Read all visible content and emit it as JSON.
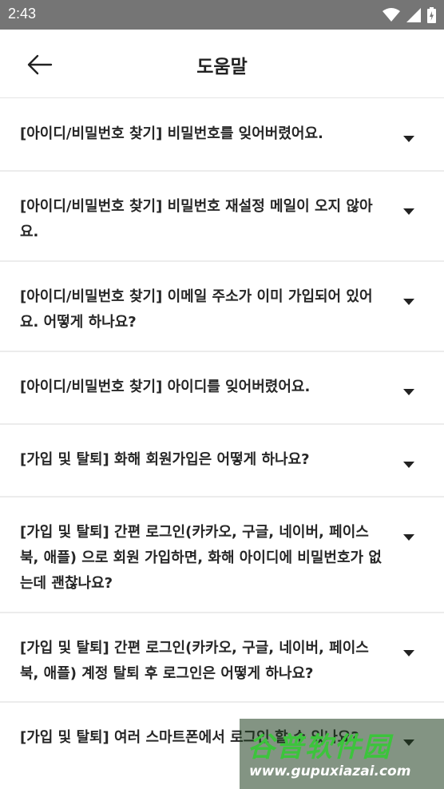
{
  "status_bar": {
    "time": "2:43"
  },
  "header": {
    "title": "도움말"
  },
  "faq": [
    {
      "question": "[아이디/비밀번호 찾기] 비밀번호를 잊어버렸어요."
    },
    {
      "question": "[아이디/비밀번호 찾기] 비밀번호 재설정 메일이 오지 않아요."
    },
    {
      "question": "[아이디/비밀번호 찾기] 이메일 주소가 이미 가입되어 있어요. 어떻게 하나요?"
    },
    {
      "question": "[아이디/비밀번호 찾기] 아이디를 잊어버렸어요."
    },
    {
      "question": "[가입 및 탈퇴] 화해 회원가입은 어떻게 하나요?"
    },
    {
      "question": "[가입 및 탈퇴] 간편 로그인(카카오, 구글, 네이버, 페이스북, 애플) 으로 회원 가입하면, 화해 아이디에 비밀번호가 없는데 괜찮나요?"
    },
    {
      "question": "[가입 및 탈퇴] 간편 로그인(카카오, 구글, 네이버, 페이스북, 애플) 계정 탈퇴 후 로그인은 어떻게 하나요?"
    },
    {
      "question": "[가입 및 탈퇴] 여러 스마트폰에서 로그인 할 수 있나요?"
    }
  ],
  "watermark": {
    "title": "谷普软件园",
    "url": "www.gupuxiazai.com"
  }
}
